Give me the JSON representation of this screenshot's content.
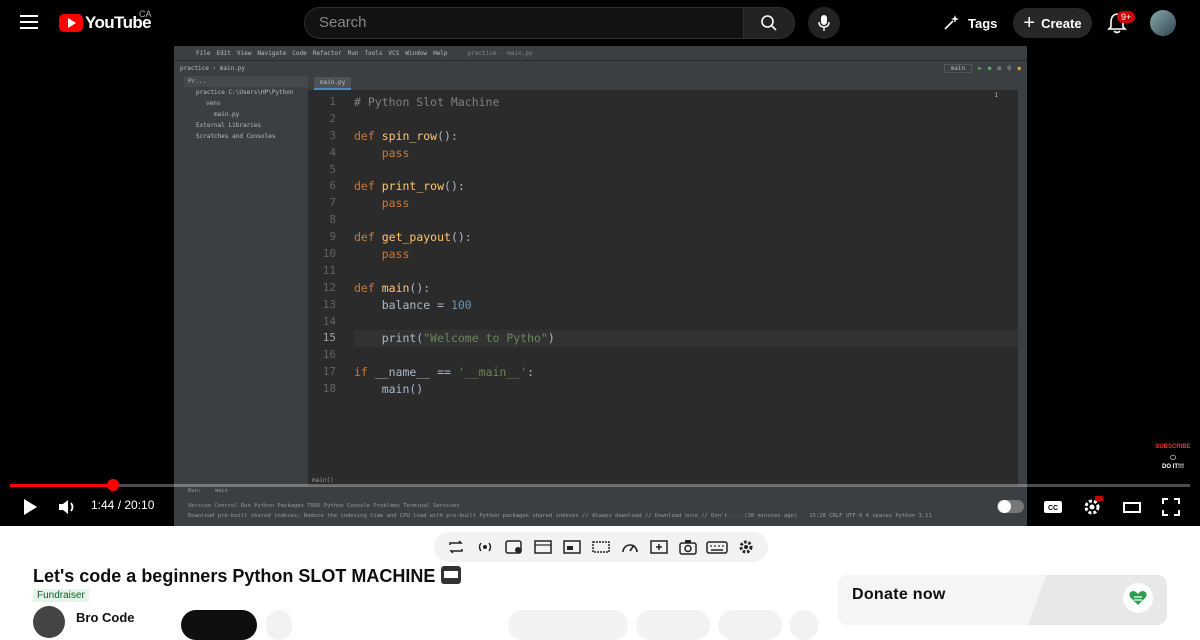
{
  "header": {
    "logo_text": "YouTube",
    "country_code": "CA",
    "search_placeholder": "Search",
    "tags_label": "Tags",
    "create_label": "Create",
    "notifications_badge": "9+"
  },
  "ide": {
    "menu": [
      "File",
      "Edit",
      "View",
      "Navigate",
      "Code",
      "Refactor",
      "Run",
      "Tools",
      "VCS",
      "Window",
      "Help",
      "practice - main.py"
    ],
    "breadcrumb": "practice  ›  main.py",
    "run_config": "main",
    "project_header": "Pr...",
    "project_tree": [
      "practice  C:\\Users\\HP\\Python",
      "venv",
      "main.py",
      "External Libraries",
      "Scratches and Consoles"
    ],
    "tab": "main.py",
    "line_numbers": [
      "1",
      "2",
      "3",
      "4",
      "5",
      "6",
      "7",
      "8",
      "9",
      "10",
      "11",
      "12",
      "13",
      "14",
      "15",
      "16",
      "17",
      "18"
    ],
    "inspection_count": "1",
    "breadcrumb_bottom": "main()",
    "run_label": "Run:",
    "run_tab": "main",
    "toolwindows": "Version Control   Run   Python Packages   TODO   Python Console   Problems   Terminal   Services",
    "status_message": "Download pre-built shared indexes: Reduce the indexing time and CPU load with pre-built Python packages shared indexes // Always download // Download once // Don't ... (38 minutes ago)",
    "status_right": "15:28  CRLF  UTF-8  4 spaces  Python 3.11"
  },
  "player": {
    "time_display": "1:44 / 20:10",
    "progress_fraction": 0.087,
    "watermark_top": "SUBSCRIBE",
    "watermark_bottom": "DO IT!!!"
  },
  "video": {
    "title": "Let's code a beginners Python SLOT MACHINE",
    "fundraiser_label": "Fundraiser",
    "channel_name": "Bro Code"
  },
  "donate": {
    "label": "Donate now"
  }
}
